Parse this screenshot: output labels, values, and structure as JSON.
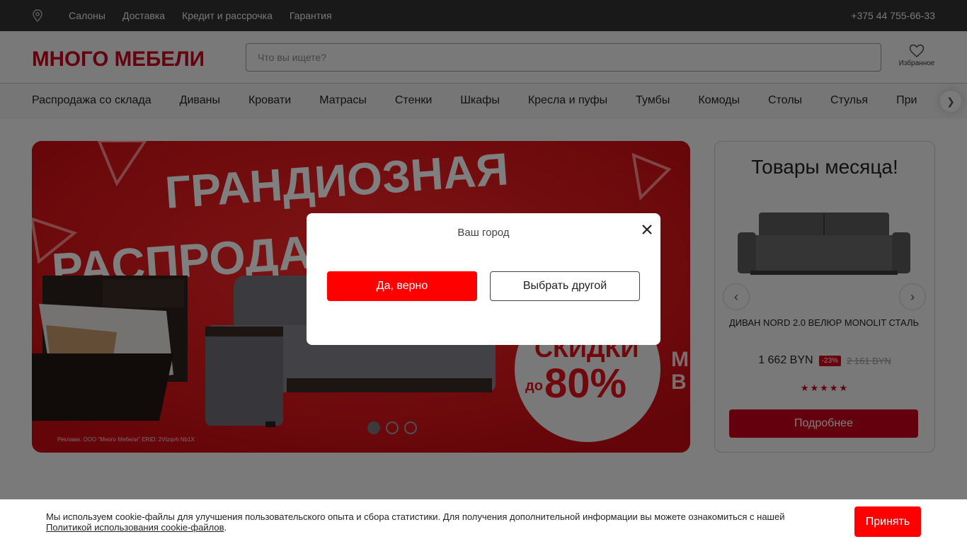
{
  "topbar": {
    "location_icon": "map-pin-icon",
    "links": [
      "Салоны",
      "Доставка",
      "Кредит и рассрочка",
      "Гарантия"
    ],
    "phone": "+375 44 755-66-33"
  },
  "header": {
    "logo_text": "МНОГО МЕБЕЛИ",
    "search_placeholder": "Что вы ищете?",
    "favorites_label": "Избранное",
    "favorites_icon": "heart-icon"
  },
  "nav": {
    "items": [
      "Распродажа со склада",
      "Диваны",
      "Кровати",
      "Матрасы",
      "Стенки",
      "Шкафы",
      "Кресла и пуфы",
      "Тумбы",
      "Комоды",
      "Столы",
      "Стулья",
      "При"
    ],
    "next_icon": "chevron-right-icon"
  },
  "banner": {
    "headline_line1": "ГРАНДИОЗНАЯ",
    "headline_line2": "РАСПРОДАЖА СКЛАДА",
    "discount_label": "СКИДКИ",
    "discount_prefix": "до",
    "discount_value": "80%",
    "side_letters": "М\nВ",
    "ad_note": "Реклама. ООО \"Много Мебели\" ERID: 2Vtzqvh Nb1X",
    "slides_count": 3,
    "active_slide": 1
  },
  "monthly": {
    "title": "Товары месяца!",
    "product_name": "ДИВАН NORD 2.0 ВЕЛЮР MONOLIT СТАЛЬ",
    "price": "1 662 BYN",
    "discount": "-23%",
    "old_price": "2 161 BYN",
    "rating_stars": "★★★★★",
    "more_button": "Подробнее",
    "prev_icon": "chevron-left-icon",
    "next_icon": "chevron-right-icon"
  },
  "city_modal": {
    "title": "Ваш город",
    "confirm_button": "Да, верно",
    "choose_button": "Выбрать другой",
    "close_icon": "close-icon"
  },
  "cookie": {
    "text": "Мы используем cookie-файлы для улучшения пользовательского опыта и сбора статистики. Для получения дополнительной информации вы можете ознакомиться с нашей ",
    "link": "Политикой использования cookie-файлов",
    "tail": ".",
    "accept_button": "Принять"
  },
  "colors": {
    "brand_red": "#ff0000",
    "dark_red": "#c8001a",
    "topbar_bg": "#333333"
  }
}
